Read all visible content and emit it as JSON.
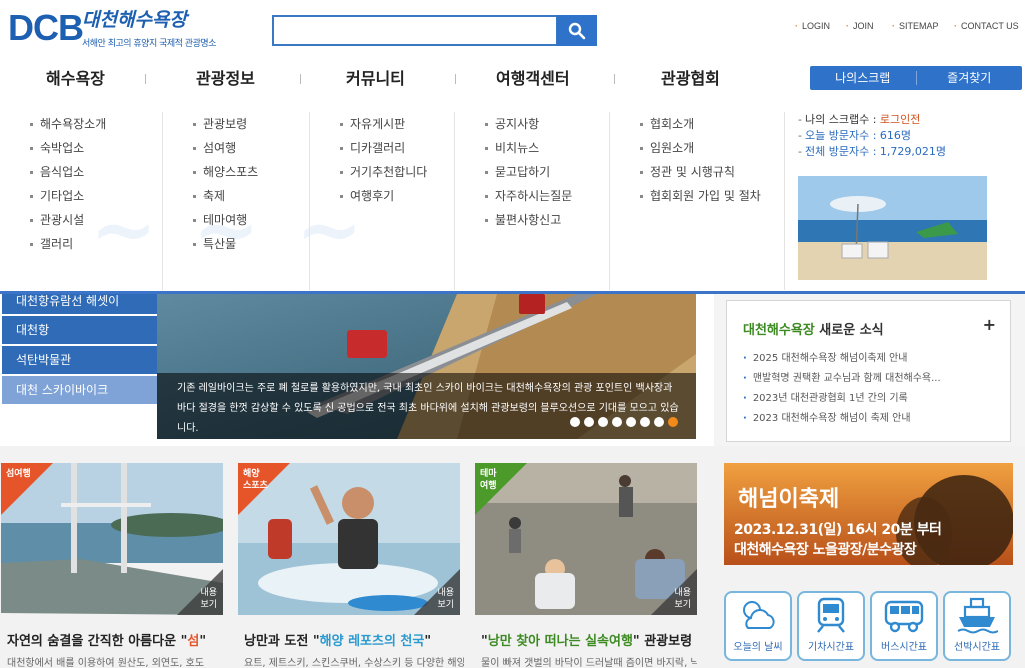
{
  "logo": {
    "mark": "DCB",
    "name": "대천해수욕장",
    "tagline": "서해안 최고의 휴양지 국제적 관광명소"
  },
  "search": {
    "placeholder": "",
    "value": ""
  },
  "util_links": [
    "LOGIN",
    "JOIN",
    "SITEMAP",
    "CONTACT US"
  ],
  "gnb": [
    "해수욕장",
    "관광정보",
    "커뮤니티",
    "여행객센터",
    "관광협회"
  ],
  "scrap_buttons": [
    "나의스크랩",
    "즐겨찾기"
  ],
  "mega_menu": [
    [
      "해수욕장소개",
      "숙박업소",
      "음식업소",
      "기타업소",
      "관광시설",
      "갤러리"
    ],
    [
      "관광보령",
      "섬여행",
      "해양스포츠",
      "축제",
      "테마여행",
      "특산물"
    ],
    [
      "자유게시판",
      "디카갤러리",
      "거기추천합니다",
      "여행후기"
    ],
    [
      "공지사항",
      "비치뉴스",
      "묻고답하기",
      "자주하시는질문",
      "불편사항신고"
    ],
    [
      "협회소개",
      "임원소개",
      "정관 및 시행규칙",
      "협회회원 가입 및 절차"
    ]
  ],
  "info": {
    "scrap_label": "나의 스크랩수 :",
    "scrap_value": "로그인전",
    "today_label": "오늘 방문자수 :",
    "today_value": "616명",
    "total_label": "전체 방문자수 :",
    "total_value": "1,729,021명"
  },
  "side_tabs": [
    "대천항유람선 해셋이",
    "대천항",
    "석탄박물관",
    "대천 스카이바이크"
  ],
  "visual_caption": "기존 레일바이크는 주로 폐 철로를 활용하였지만, 국내 최초인 스카이 바이크는 대천해수욕장의 관광 포인트인 백사장과 바다 절경을 한껏 감상할 수 있도록 신 공법으로 전국 최초 바다위에 설치해 관광보령의 블루오션으로 기대를 모으고 있습니다.",
  "news": {
    "title_hl": "대천해수욕장",
    "title_rest": " 새로운 소식",
    "items": [
      "2025 대천해수욕장 해넘이축제 안내",
      "맨발혁명 권택환 교수님과 함께 대천해수욕...",
      "2023년 대천관광협회 1년 간의 기록",
      "2023 대천해수욕장 해넘이 축제 안내"
    ]
  },
  "cards": [
    {
      "tag": "섬여행",
      "more": "내용\n보기",
      "title_pre": "자연의 숨결을 간직한 아름다운 \"",
      "title_hl": "섬",
      "title_post": "\"",
      "desc": "대천항에서 배를 이용하여 원산도, 외연도, 호도"
    },
    {
      "tag": "해양\n스포츠",
      "more": "내용\n보기",
      "title_pre": "낭만과 도전 \"",
      "title_hl": "해양 레포츠의 천국",
      "title_post": "\"",
      "desc": "요트, 제트스키, 스킨스쿠버, 수상스키 등 다양한 해양"
    },
    {
      "tag": "테마\n여행",
      "more": "내용\n보기",
      "title_pre": "\"",
      "title_hl": "낭만 찾아 떠나는 실속여행",
      "title_post": "\" 관광보령",
      "desc": "물이 빠져 갯벌의 바닥이 드러날때 즘이면 바지락, 낙지,"
    }
  ],
  "festival": {
    "title": "해넘이축제",
    "date": "2023.12.31(일) 16시 20분 부터",
    "place": "대천해수욕장 노을광장/분수광장"
  },
  "quick_links": [
    "오늘의 날씨",
    "기차시간표",
    "버스시간표",
    "선박시간표"
  ],
  "colors": {
    "brand": "#2e72c9",
    "accent": "#f08a1a",
    "green": "#3d8a22"
  }
}
